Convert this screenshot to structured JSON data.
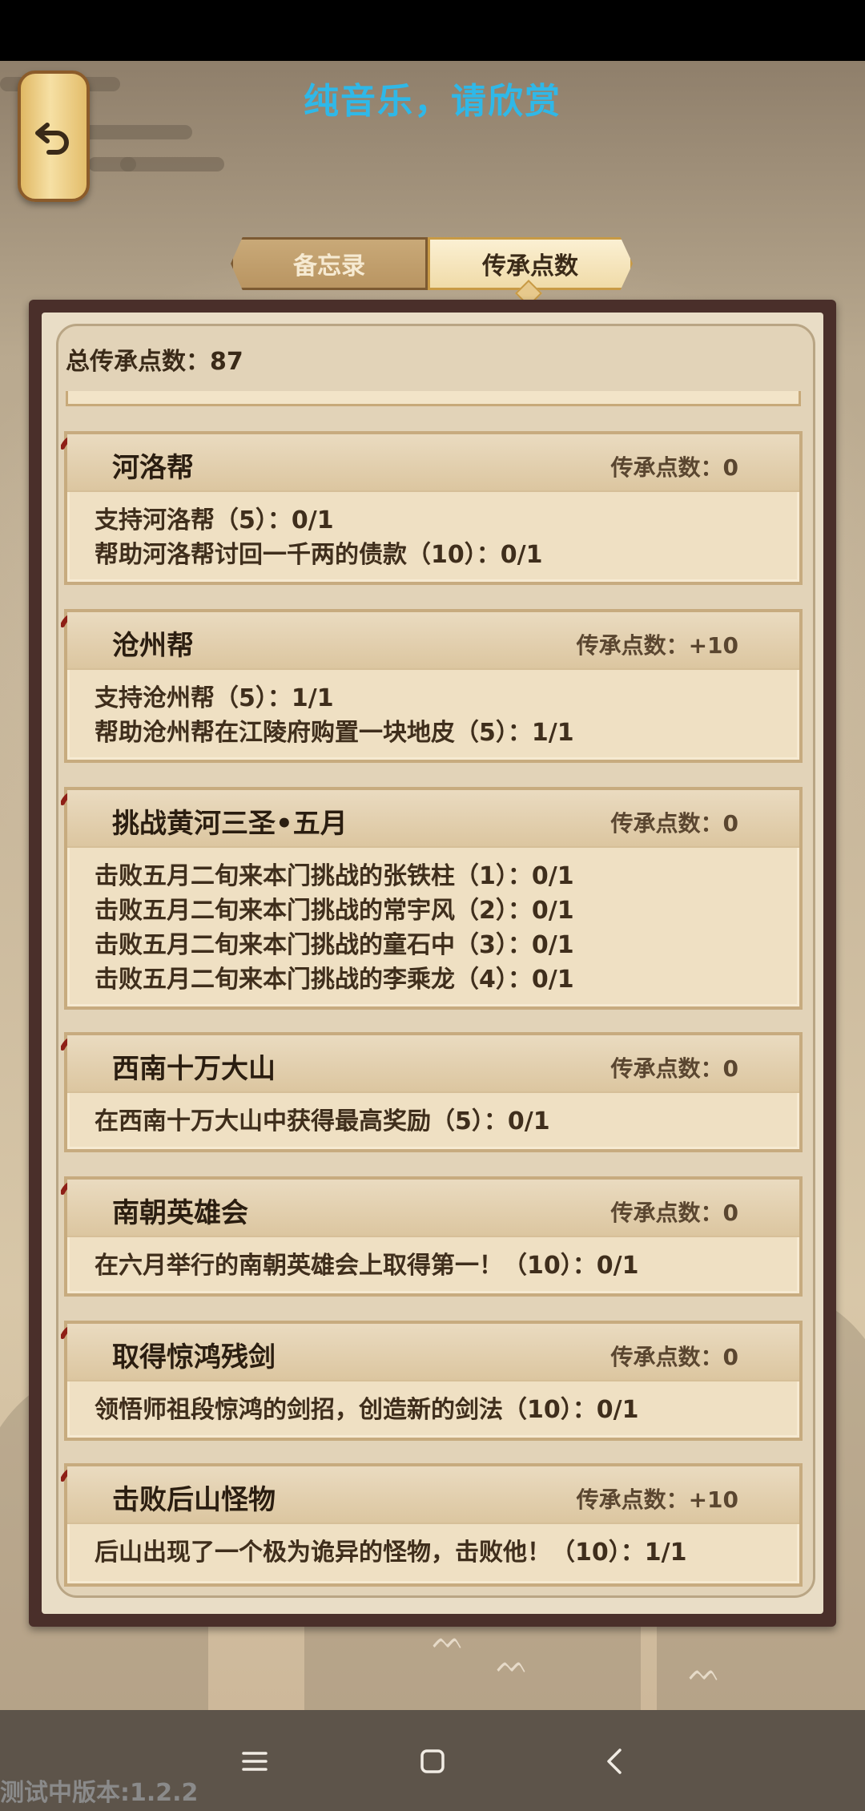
{
  "header": {
    "title": "纯音乐，请欣赏"
  },
  "tabs": [
    {
      "label": "备忘录",
      "active": false
    },
    {
      "label": "传承点数",
      "active": true
    }
  ],
  "summary": {
    "total_label": "总传承点数：87"
  },
  "cards": [
    {
      "name": "河洛帮",
      "points": "传承点数：0",
      "requirements": [
        "支持河洛帮（5）：0/1",
        "帮助河洛帮讨回一千两的债款（10）：0/1"
      ]
    },
    {
      "name": "沧州帮",
      "points": "传承点数：+10",
      "requirements": [
        "支持沧州帮（5）：1/1",
        "帮助沧州帮在江陵府购置一块地皮（5）：1/1"
      ]
    },
    {
      "name": "挑战黄河三圣•五月",
      "points": "传承点数：0",
      "requirements": [
        "击败五月二旬来本门挑战的张铁柱（1）：0/1",
        "击败五月二旬来本门挑战的常宇风（2）：0/1",
        "击败五月二旬来本门挑战的童石中（3）：0/1",
        "击败五月二旬来本门挑战的李乘龙（4）：0/1"
      ]
    },
    {
      "name": "西南十万大山",
      "points": "传承点数：0",
      "requirements": [
        "在西南十万大山中获得最高奖励（5）：0/1"
      ]
    },
    {
      "name": "南朝英雄会",
      "points": "传承点数：0",
      "requirements": [
        "在六月举行的南朝英雄会上取得第一！（10）：0/1"
      ]
    },
    {
      "name": "取得惊鸿残剑",
      "points": "传承点数：0",
      "requirements": [
        "领悟师祖段惊鸿的剑招，创造新的剑法（10）：0/1"
      ]
    },
    {
      "name": "击败后山怪物",
      "points": "传承点数：+10",
      "requirements": [
        "后山出现了一个极为诡异的怪物，击败他！（10）：1/1"
      ]
    }
  ],
  "footer": {
    "version": "测试中版本:1.2.2"
  },
  "icons": {
    "back": "back-arrow-icon",
    "menu": "menu-icon",
    "home": "home-square-icon",
    "nav_back": "chevron-left-icon"
  },
  "colors": {
    "title": "#2fb8e8",
    "frame": "#4a2f2a",
    "card": "#efe0c3"
  }
}
